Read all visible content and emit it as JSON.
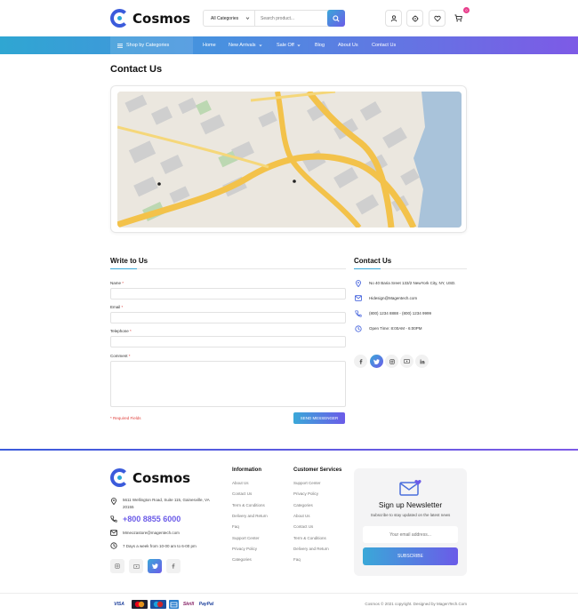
{
  "header": {
    "brand": "Cosmos",
    "search": {
      "category": "All Categories",
      "placeholder": "Search product..."
    },
    "cart_count": "0",
    "icons": [
      "user-icon",
      "target-icon",
      "heart-icon",
      "cart-icon"
    ]
  },
  "nav": {
    "shop_by": "Shop by Categories",
    "links": [
      "Home",
      "New Arrivals",
      "Sale Off",
      "Blog",
      "About Us",
      "Contact Us"
    ]
  },
  "page": {
    "title": "Contact Us"
  },
  "form": {
    "title": "Write to Us",
    "name_label": "Name",
    "email_label": "Email",
    "telephone_label": "Telephone",
    "comment_label": "Comment",
    "required_mark": "*",
    "required_note": "* Required Fields",
    "send_label": "SEND MESSENGER"
  },
  "contact": {
    "title": "Contact Us",
    "address": "No 40 Baria Sreet 133/2 NewYork City, NY, USD.",
    "email": "Hidesign@Magentech.com",
    "phone": "(800) 1234 8888 - (800) 1234 9999",
    "hours": "Open Time: 8:00AM - 6:00PM",
    "socials": [
      "facebook-icon",
      "twitter-icon",
      "instagram-icon",
      "youtube-icon",
      "linkedin-icon"
    ]
  },
  "footer": {
    "brand": "Cosmos",
    "address": "5611 Wellington Road, Suite 115, Gainesville, VA 20155",
    "phone": "+800 8855 6000",
    "email": "Mmeozastore@magentech.com",
    "hours": "7 Days a week from 10-00 am to 6-00 pm",
    "socials": [
      "instagram-icon",
      "youtube-icon",
      "twitter-icon",
      "facebook-icon"
    ],
    "information": {
      "title": "Information",
      "links": [
        "About Us",
        "Contact Us",
        "Term & Conditions",
        "Delivery and Return",
        "Faq",
        "Support Center",
        "Privacy Policy",
        "Categories"
      ]
    },
    "customer_services": {
      "title": "Customer Services",
      "links": [
        "Support Center",
        "Privacy Policy",
        "Categories",
        "About Us",
        "Contact Us",
        "Term & Conditions",
        "Delivery and Return",
        "Faq"
      ]
    },
    "newsletter": {
      "title": "Sign up Newsletter",
      "subtitle": "Subscribe to stay updated on the latest news",
      "placeholder": "Your email address...",
      "button": "SUBSCRIBE"
    },
    "payments": [
      "VISA",
      "Mastercard",
      "Maestro",
      "Amex",
      "Skrill",
      "PayPal"
    ],
    "payment_labels": {
      "visa": "VISA",
      "skrill": "Skrill",
      "paypal": "PayPal"
    },
    "copyright": "Cosmos © 2021 copyright. Designed by MagenTech.Com"
  },
  "colors": {
    "accent_blue": "#3aa8d8",
    "accent_purple": "#6b5be8",
    "required_red": "#e0413d"
  }
}
